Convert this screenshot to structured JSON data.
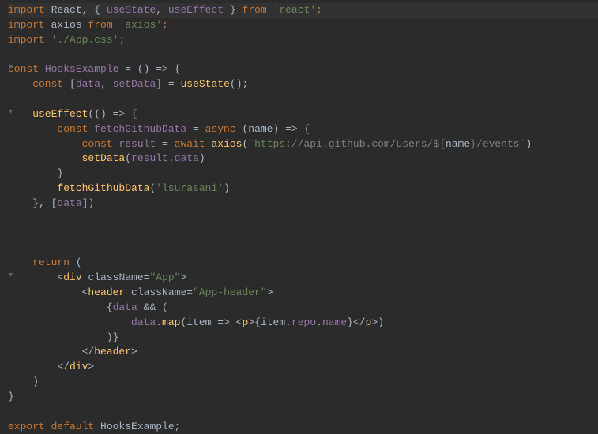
{
  "code": {
    "line1": {
      "t1": "import ",
      "t2": "React",
      "t3": ", { ",
      "t4": "useState",
      "t5": ", ",
      "t6": "useEffect ",
      "t7": "} ",
      "t8": "from ",
      "t9": "'react'",
      "t10": ";"
    },
    "line2": {
      "t1": "import ",
      "t2": "axios ",
      "t3": "from ",
      "t4": "'axios'",
      "t5": ";"
    },
    "line3": {
      "t1": "import ",
      "t2": "'./App.css'",
      "t3": ";"
    },
    "line5": {
      "t1": "const ",
      "t2": "HooksExample ",
      "t3": "= () => {"
    },
    "line6": {
      "t1": "    const ",
      "t2": "[",
      "t3": "data",
      "t4": ", ",
      "t5": "setData",
      "t6": "] = ",
      "t7": "useState",
      "t8": "();"
    },
    "line8": {
      "t1": "    useEffect",
      "t2": "(() => {"
    },
    "line9": {
      "t1": "        const ",
      "t2": "fetchGithubData ",
      "t3": "= ",
      "t4": "async ",
      "t5": "(",
      "t6": "name",
      "t7": ") => {"
    },
    "line10": {
      "t1": "            const ",
      "t2": "result ",
      "t3": "= ",
      "t4": "await ",
      "t5": "axios",
      "t6": "(",
      "t7": "`https:",
      "t8": "//api.github.com/users/${",
      "t9": "name",
      "t10": "}/events`",
      "t11": ")"
    },
    "line11": {
      "t1": "            setData",
      "t2": "(",
      "t3": "result",
      "t4": ".",
      "t5": "data",
      "t6": ")"
    },
    "line12": {
      "t1": "        }"
    },
    "line13": {
      "t1": "        fetchGithubData",
      "t2": "(",
      "t3": "'lsurasani'",
      "t4": ")"
    },
    "line14": {
      "t1": "    }, [",
      "t2": "data",
      "t3": "])"
    },
    "line18": {
      "t1": "    return ",
      "t2": "("
    },
    "line19": {
      "t1": "        <",
      "t2": "div ",
      "t3": "className",
      "t4": "=",
      "t5": "\"App\"",
      "t6": ">"
    },
    "line20": {
      "t1": "            <",
      "t2": "header ",
      "t3": "className",
      "t4": "=",
      "t5": "\"App-header\"",
      "t6": ">"
    },
    "line21": {
      "t1": "                {",
      "t2": "data ",
      "t3": "&& ("
    },
    "line22": {
      "t1": "                    data",
      "t2": ".",
      "t3": "map",
      "t4": "(",
      "t5": "item ",
      "t6": "=> <",
      "t7": "p",
      "t8": ">{",
      "t9": "item",
      "t10": ".",
      "t11": "repo",
      "t12": ".",
      "t13": "name",
      "t14": "}</",
      "t15": "p",
      "t16": ">)"
    },
    "line23": {
      "t1": "                )}"
    },
    "line24": {
      "t1": "            </",
      "t2": "header",
      "t3": ">"
    },
    "line25": {
      "t1": "        </",
      "t2": "div",
      "t3": ">"
    },
    "line26": {
      "t1": "    )"
    },
    "line27": {
      "t1": "}"
    },
    "line29": {
      "t1": "export default ",
      "t2": "HooksExample;"
    }
  }
}
